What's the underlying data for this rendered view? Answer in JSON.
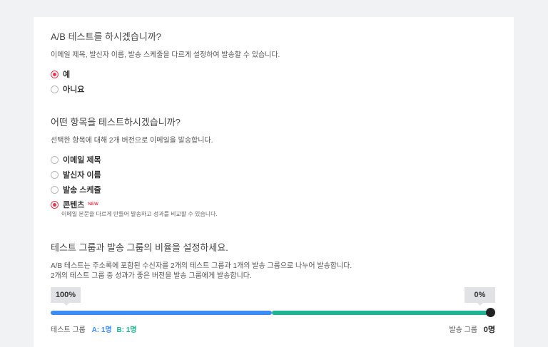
{
  "colors": {
    "accent_red": "#e8384f",
    "blue": "#3d8cf5",
    "teal": "#1db493",
    "badge": "#e8384f"
  },
  "section1": {
    "title": "A/B 테스트를 하시겠습니까?",
    "desc": "이메일 제목, 발신자 이름, 발송 스케줄을 다르게 설정하여 발송할 수 있습니다.",
    "options": [
      {
        "label": "예",
        "checked": true
      },
      {
        "label": "아니요",
        "checked": false
      }
    ]
  },
  "section2": {
    "title": "어떤 항목을 테스트하시겠습니까?",
    "desc": "선택한 항목에 대해 2개 버전으로 이메일을 발송합니다.",
    "options": [
      {
        "label": "이메일 제목",
        "checked": false
      },
      {
        "label": "발신자 이름",
        "checked": false
      },
      {
        "label": "발송 스케줄",
        "checked": false
      },
      {
        "label": "콘텐츠",
        "checked": true,
        "badge": "NEW",
        "sub_desc": "이메일 본문을 다르게 만들어 발송하고 성과를 비교할 수 있습니다."
      }
    ]
  },
  "section3": {
    "title": "테스트 그룹과 발송 그룹의 비율을 설정하세요.",
    "desc_line1": "A/B 테스트는 주소록에 포함된 수신자를 2개의 테스트 그룹과 1개의 발송 그룹으로 나누어 발송합니다.",
    "desc_line2": "2개의 테스트 그룹 중 성과가 좋은 버전을 발송 그룹에게 발송합니다.",
    "slider": {
      "test_percent_label": "100%",
      "send_percent_label": "0%",
      "test_fraction": 1.0,
      "blue_fraction": 0.5
    },
    "footer": {
      "test_group_label": "테스트 그룹",
      "group_a": "A: 1명",
      "group_b": "B: 1명",
      "send_group_label": "발송 그룹",
      "send_count": "0명"
    }
  }
}
